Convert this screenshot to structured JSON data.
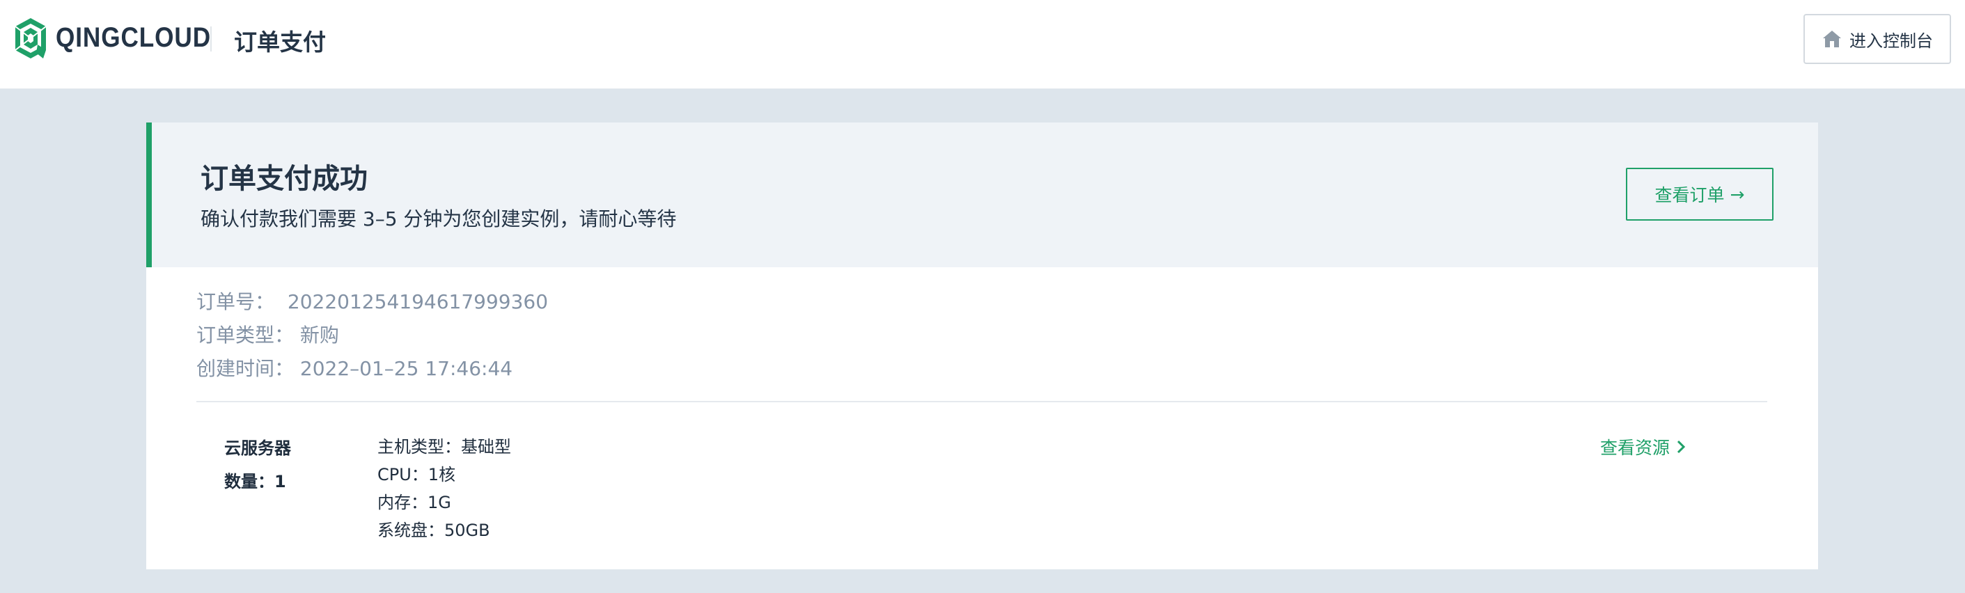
{
  "header": {
    "brand": "QINGCLOUD",
    "page_title": "订单支付",
    "console_button": "进入控制台"
  },
  "banner": {
    "title": "订单支付成功",
    "description": "确认付款我们需要 3–5 分钟为您创建实例，请耐心等待",
    "view_order_label": "查看订单",
    "view_order_arrow": "→"
  },
  "order": {
    "number_label": "订单号：",
    "number_value": "202201254194617999360",
    "type_label": "订单类型：",
    "type_value": "新购",
    "created_label": "创建时间：",
    "created_value": "2022–01–25 17:46:44"
  },
  "product": {
    "name": "云服务器",
    "quantity": "数量：1",
    "specs": [
      "主机类型：基础型",
      "CPU：1核",
      "内存：1G",
      "系统盘：50GB"
    ],
    "view_resource_label": "查看资源"
  },
  "colors": {
    "accent": "#1fa068",
    "background": "#dde5ec",
    "banner_bg": "#eff3f7",
    "text_dark": "#243446",
    "text_muted": "#8392a5"
  },
  "icons": {
    "brand": "qingcloud-logo",
    "console": "home-icon",
    "resource": "chevron-right-icon"
  }
}
